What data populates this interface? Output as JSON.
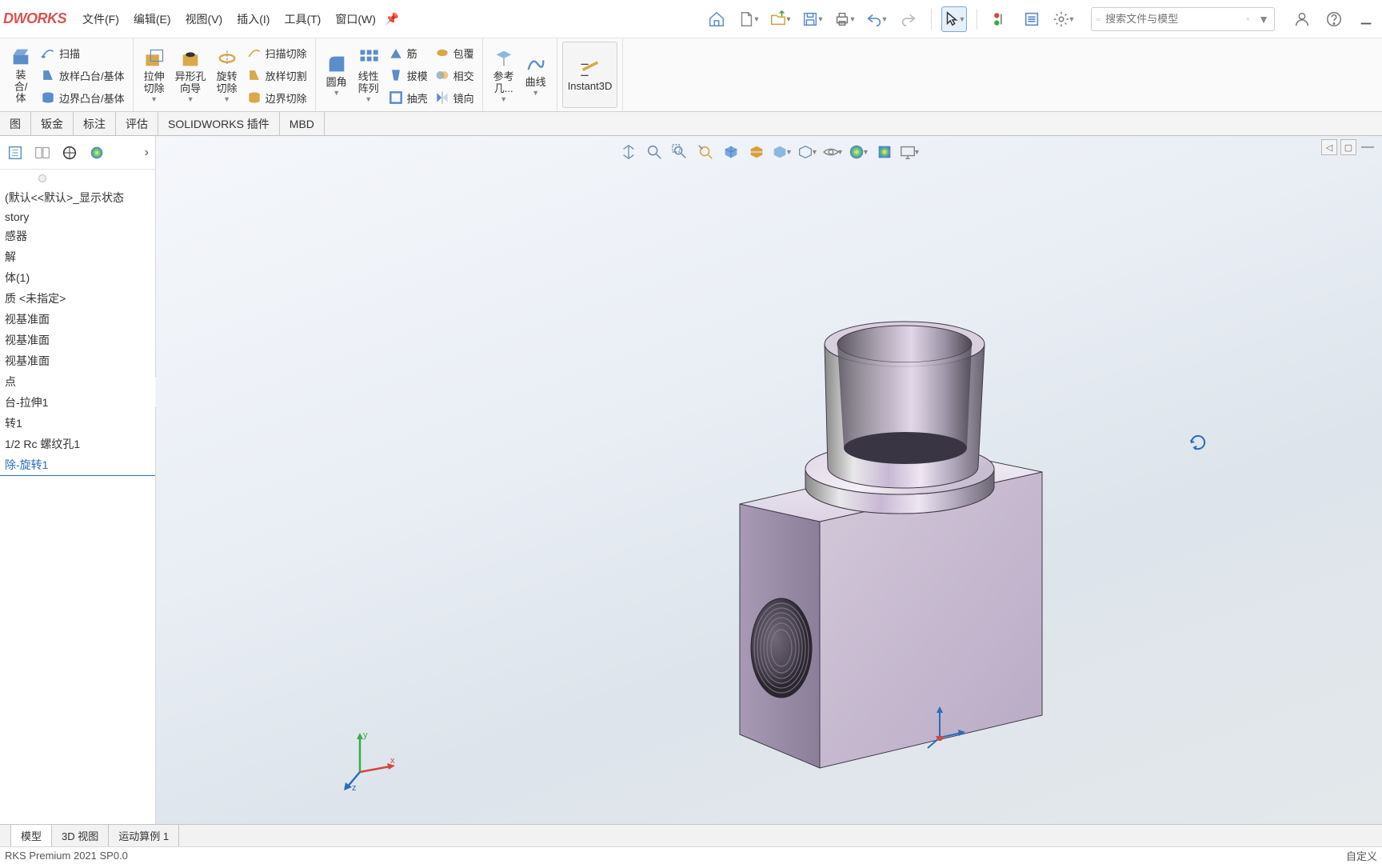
{
  "app": {
    "logo_text": "DWORKS"
  },
  "menu": {
    "file": "文件(F)",
    "edit": "编辑(E)",
    "view": "视图(V)",
    "insert": "插入(I)",
    "tools": "工具(T)",
    "window": "窗口(W)"
  },
  "search": {
    "placeholder": "搜索文件与模型"
  },
  "ribbon": {
    "group1": {
      "sweep": "扫描",
      "lofted_boss": "放样凸台/基体",
      "boundary_boss": "边界凸台/基体"
    },
    "group2": {
      "extruded_cut": "拉伸\n切除",
      "hole_wizard": "异形孔\n向导",
      "revolve_cut": "旋转\n切除",
      "sweep_cut": "扫描切除",
      "loft_cut": "放样切割",
      "boundary_cut": "边界切除"
    },
    "group3": {
      "fillet": "圆角",
      "linear_pattern": "线性\n阵列",
      "rib": "筋",
      "draft": "拔模",
      "shell": "抽壳",
      "wrap": "包覆",
      "intersect": "相交",
      "mirror": "镜向"
    },
    "group4": {
      "ref_geom": "参考\n几...",
      "curve": "曲线"
    },
    "group5": {
      "instant3d": "Instant3D"
    }
  },
  "tabs": {
    "t1": "图",
    "t2": "钣金",
    "t3": "标注",
    "t4": "评估",
    "t5": "SOLIDWORKS 插件",
    "t6": "MBD"
  },
  "tree": {
    "root": "(默认<<默认>_显示状态",
    "items": [
      "story",
      "感器",
      "解",
      "体(1)",
      "质 <未指定>",
      "视基准面",
      "视基准面",
      "视基准面",
      "点",
      "台-拉伸1",
      "转1",
      "1/2 Rc 螺纹孔1",
      "除-旋转1"
    ]
  },
  "bottom_tabs": {
    "bt1": "模型",
    "bt2": "3D 视图",
    "bt3": "运动算例 1"
  },
  "status": {
    "left": "RKS Premium 2021 SP0.0",
    "right": "自定义"
  },
  "triad": {
    "x": "x",
    "y": "y",
    "z": "z"
  }
}
